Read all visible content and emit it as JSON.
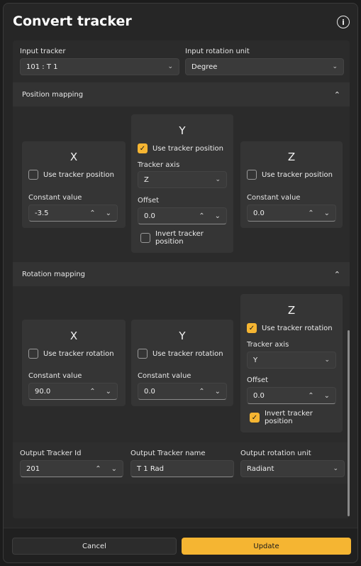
{
  "dialog": {
    "title": "Convert tracker",
    "info_icon": "i"
  },
  "top": {
    "input_tracker_label": "Input tracker",
    "input_tracker_value": "101 : T 1",
    "input_rotation_unit_label": "Input rotation unit",
    "input_rotation_unit_value": "Degree"
  },
  "position_mapping": {
    "header": "Position mapping",
    "x": {
      "title": "X",
      "use_label": "Use tracker position",
      "use_checked": false,
      "constant_label": "Constant value",
      "constant_value": "-3.5"
    },
    "y": {
      "title": "Y",
      "use_label": "Use tracker position",
      "use_checked": true,
      "axis_label": "Tracker axis",
      "axis_value": "Z",
      "offset_label": "Offset",
      "offset_value": "0.0",
      "invert_label": "Invert tracker position",
      "invert_checked": false
    },
    "z": {
      "title": "Z",
      "use_label": "Use tracker position",
      "use_checked": false,
      "constant_label": "Constant value",
      "constant_value": "0.0"
    }
  },
  "rotation_mapping": {
    "header": "Rotation mapping",
    "x": {
      "title": "X",
      "use_label": "Use tracker rotation",
      "use_checked": false,
      "constant_label": "Constant value",
      "constant_value": "90.0"
    },
    "y": {
      "title": "Y",
      "use_label": "Use tracker rotation",
      "use_checked": false,
      "constant_label": "Constant value",
      "constant_value": "0.0"
    },
    "z": {
      "title": "Z",
      "use_label": "Use tracker rotation",
      "use_checked": true,
      "axis_label": "Tracker axis",
      "axis_value": "Y",
      "offset_label": "Offset",
      "offset_value": "0.0",
      "invert_label": "Invert tracker position",
      "invert_checked": true
    }
  },
  "output": {
    "id_label": "Output Tracker Id",
    "id_value": "201",
    "name_label": "Output Tracker name",
    "name_value": "T 1 Rad",
    "unit_label": "Output rotation unit",
    "unit_value": "Radiant"
  },
  "footer": {
    "cancel_label": "Cancel",
    "update_label": "Update"
  },
  "icons": {
    "chevron_down": "⌄",
    "chevron_up": "︿",
    "spin_up": "︿",
    "spin_down": "﹀",
    "check": "✓"
  },
  "colors": {
    "accent": "#f5b532",
    "background": "#262626"
  }
}
